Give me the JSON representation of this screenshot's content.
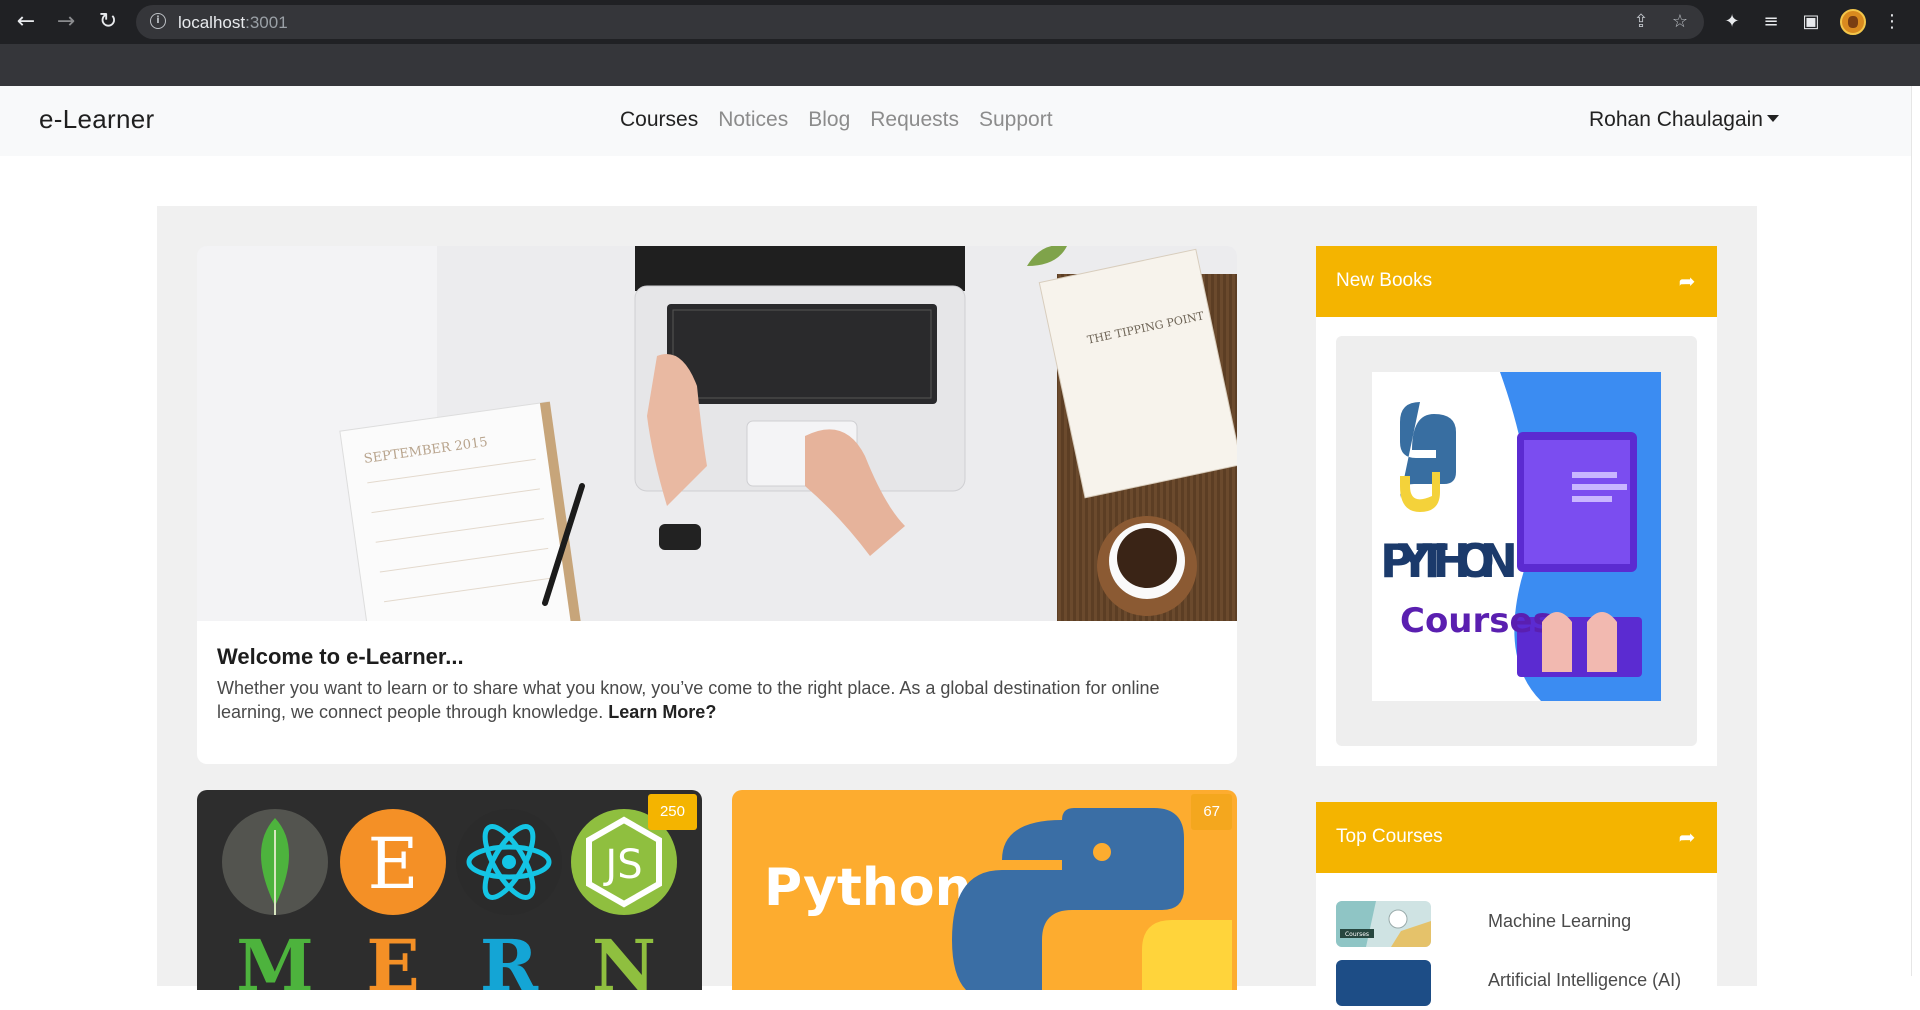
{
  "browser": {
    "url_host": "localhost",
    "url_port": ":3001"
  },
  "navbar": {
    "brand": "e-Learner",
    "menu": [
      "Courses",
      "Notices",
      "Blog",
      "Requests",
      "Support"
    ],
    "active": "Courses",
    "user": "Rohan Chaulagain"
  },
  "hero": {
    "title": "Welcome to e-Learner...",
    "description": "Whether you want to learn or to share what you know, you’ve come to the right place. As a global destination for online learning, we connect people through knowledge.",
    "learn_more": "Learn More?",
    "image_text": {
      "calendar": "SEPTEMBER 2015",
      "book": "THE TIPPING POINT"
    }
  },
  "cards": [
    {
      "name": "MERN",
      "badge": "250",
      "letters": [
        "M",
        "E",
        "R",
        "N"
      ]
    },
    {
      "name": "Python",
      "badge": "67",
      "title": "Python"
    }
  ],
  "new_books": {
    "title": "New Books",
    "cover_title": "PYTHON",
    "cover_subtitle": "Courses"
  },
  "top_courses": {
    "title": "Top Courses",
    "items": [
      {
        "name": "Machine Learning",
        "thumb_label": "Courses"
      },
      {
        "name": "Artificial Intelligence (AI)"
      }
    ]
  },
  "colors": {
    "accent": "#f4b400",
    "navbar_bg": "#f8f9fa",
    "content_bg": "#f0f0f0"
  }
}
